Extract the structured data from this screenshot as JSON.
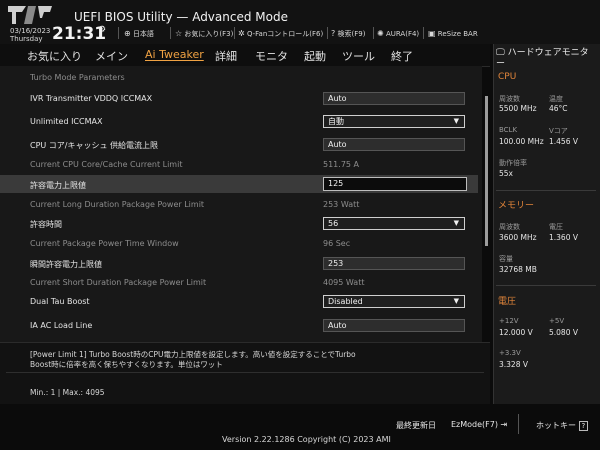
{
  "header": {
    "title": "UEFI BIOS Utility — Advanced Mode",
    "date": "03/16/2023",
    "day": "Thursday",
    "time": "21:31",
    "toolbar": [
      {
        "icon": "globe-icon",
        "label": "日本語"
      },
      {
        "icon": "star-icon",
        "label": "お気に入り(F3)"
      },
      {
        "icon": "fan-icon",
        "label": "Q-Fanコントロール(F6)"
      },
      {
        "icon": "help-icon",
        "label": "検索(F9)"
      },
      {
        "icon": "aura-icon",
        "label": "AURA(F4)"
      },
      {
        "icon": "resize-bar-icon",
        "label": "ReSize BAR"
      }
    ]
  },
  "menu": {
    "items": [
      "お気に入り",
      "メイン",
      "Ai Tweaker",
      "詳細",
      "モニタ",
      "起動",
      "ツール",
      "終了"
    ],
    "active": "Ai Tweaker"
  },
  "settings": {
    "section": "Turbo Mode Parameters",
    "rows": [
      {
        "label": "IVR Transmitter VDDQ ICCMAX",
        "value": "Auto",
        "type": "input"
      },
      {
        "label": "Unlimited ICCMAX",
        "value": "自動",
        "type": "select"
      },
      {
        "label": "CPU コア/キャッシュ 供給電流上限",
        "value": "Auto",
        "type": "input"
      },
      {
        "label": "Current CPU Core/Cache Current Limit",
        "value": "511.75 A",
        "type": "readonly"
      },
      {
        "label": "許容電力上限値",
        "value": "125",
        "type": "input-selected"
      },
      {
        "label": "Current Long Duration Package Power Limit",
        "value": "253 Watt",
        "type": "readonly"
      },
      {
        "label": "許容時間",
        "value": "56",
        "type": "select"
      },
      {
        "label": "Current Package Power Time Window",
        "value": "96 Sec",
        "type": "readonly"
      },
      {
        "label": "瞬間許容電力上限値",
        "value": "253",
        "type": "input"
      },
      {
        "label": "Current Short Duration Package Power Limit",
        "value": "4095 Watt",
        "type": "readonly"
      },
      {
        "label": "Dual Tau Boost",
        "value": "Disabled",
        "type": "select"
      },
      {
        "label": "IA AC Load Line",
        "value": "Auto",
        "type": "input"
      }
    ]
  },
  "help": {
    "line1": "[Power Limit 1] Turbo Boost時のCPU電力上限値を設定します。高い値を設定することでTurbo",
    "line2": "Boost時に倍率を高く保ちやすくなります。単位はワット",
    "minmax": "Min.: 1   |   Max.: 4095"
  },
  "hardware_monitor": {
    "title": "ハードウェアモニター",
    "cpu": {
      "section": "CPU",
      "freq_label": "周波数",
      "freq": "5500 MHz",
      "temp_label": "温度",
      "temp": "46°C",
      "bclk_label": "BCLK",
      "bclk": "100.00 MHz",
      "vcore_label": "Vコア",
      "vcore": "1.456 V",
      "ratio_label": "動作倍率",
      "ratio": "55x"
    },
    "memory": {
      "section": "メモリー",
      "freq_label": "周波数",
      "freq": "3600 MHz",
      "volt_label": "電圧",
      "volt": "1.360 V",
      "cap_label": "容量",
      "cap": "32768 MB"
    },
    "voltage": {
      "section": "電圧",
      "v12_label": "+12V",
      "v12": "12.000 V",
      "v5_label": "+5V",
      "v5": "5.080 V",
      "v33_label": "+3.3V",
      "v33": "3.328 V"
    }
  },
  "footer": {
    "last_modified": "最終更新日",
    "ezmode": "EzMode(F7)",
    "hotkeys": "ホットキー",
    "hotkeys_key": "?",
    "version": "Version 2.22.1286 Copyright (C) 2023 AMI"
  },
  "colors": {
    "accent": "#e2853a",
    "active_tab": "#f0a243",
    "panel": "#181818"
  }
}
